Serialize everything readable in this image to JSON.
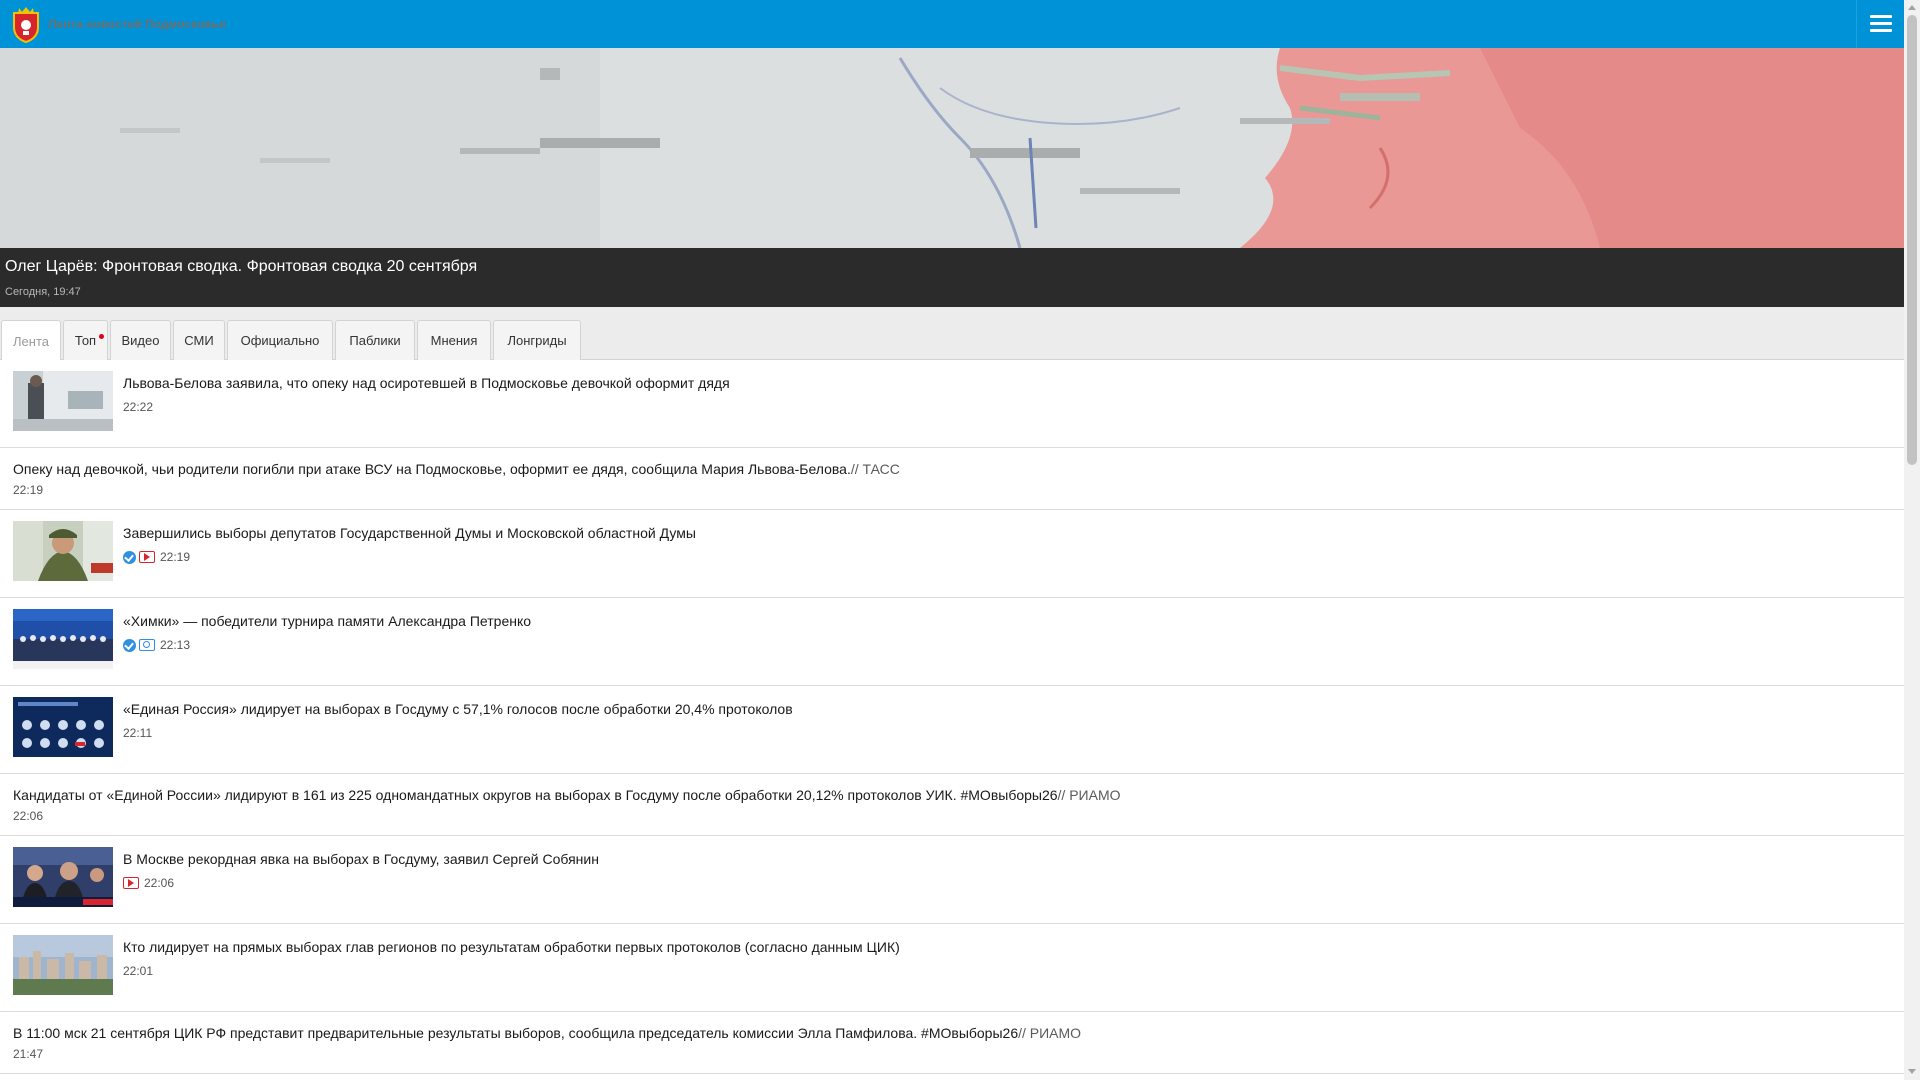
{
  "header": {
    "brand": "Лента новостей Подмосковья",
    "logo_icon": "moscow-oblast-coat-of-arms-icon",
    "menu_icon": "hamburger-menu-icon",
    "color": "#0092d6"
  },
  "hero": {
    "title": "Олег Царёв: Фронтовая сводка. Фронтовая сводка 20 сентября",
    "time": "Сегодня, 19:47"
  },
  "tabs": [
    {
      "label": "Лента",
      "active": true
    },
    {
      "label": "Топ",
      "has_dot": true
    },
    {
      "label": "Видео"
    },
    {
      "label": "СМИ"
    },
    {
      "label": "Официально"
    },
    {
      "label": "Паблики"
    },
    {
      "label": "Мнения"
    },
    {
      "label": "Лонгриды"
    }
  ],
  "feed": [
    {
      "title": "Львова-Белова заявила, что опеку над осиротевшей в Подмосковье девочкой оформит дядя",
      "time": "22:22",
      "thumb": "hospital-corridor-photo"
    },
    {
      "title": "Опеку над девочкой, чьи родители погибли при атаке ВСУ на Подмосковье, оформит ее дядя, сообщила Мария Львова-Белова.",
      "source": "// ТАСС",
      "time": "22:19"
    },
    {
      "title": "Завершились выборы депутатов Государственной Думы и Московской областной Думы",
      "time": "22:19",
      "badges": [
        "verified-icon",
        "video-icon"
      ],
      "thumb": "military-man-photo"
    },
    {
      "title": "«Химки» — победители турнира памяти Александра Петренко",
      "time": "22:13",
      "badges": [
        "verified-icon",
        "photo-icon"
      ],
      "thumb": "team-group-photo"
    },
    {
      "title": "«Единая Россия» лидирует на выборах в Госдуму с 57,1% голосов после обработки 20,4% протоколов",
      "time": "22:11",
      "thumb": "election-results-screen-photo"
    },
    {
      "title": "Кандидаты от «Единой России» лидируют в 161 из 225 одномандатных округов на выборах в Госдуму после обработки 20,12% протоколов УИК. #МОвыборы26",
      "source": "// РИАМО",
      "time": "22:06"
    },
    {
      "title": "В Москве рекордная явка на выборах в Госдуму, заявил Сергей Собянин",
      "time": "22:06",
      "badges": [
        "video-icon"
      ],
      "thumb": "press-conference-photo"
    },
    {
      "title": "Кто лидирует на прямых выборах глав регионов по результатам обработки первых протоколов (согласно данным ЦИК)",
      "time": "22:01",
      "thumb": "city-skyline-photo"
    },
    {
      "title": "В 11:00 мск 21 сентября ЦИК РФ представит предварительные результаты выборов, сообщила председатель комиссии Элла Памфилова. #МОвыборы26",
      "source": "// РИАМО",
      "time": "21:47"
    }
  ]
}
